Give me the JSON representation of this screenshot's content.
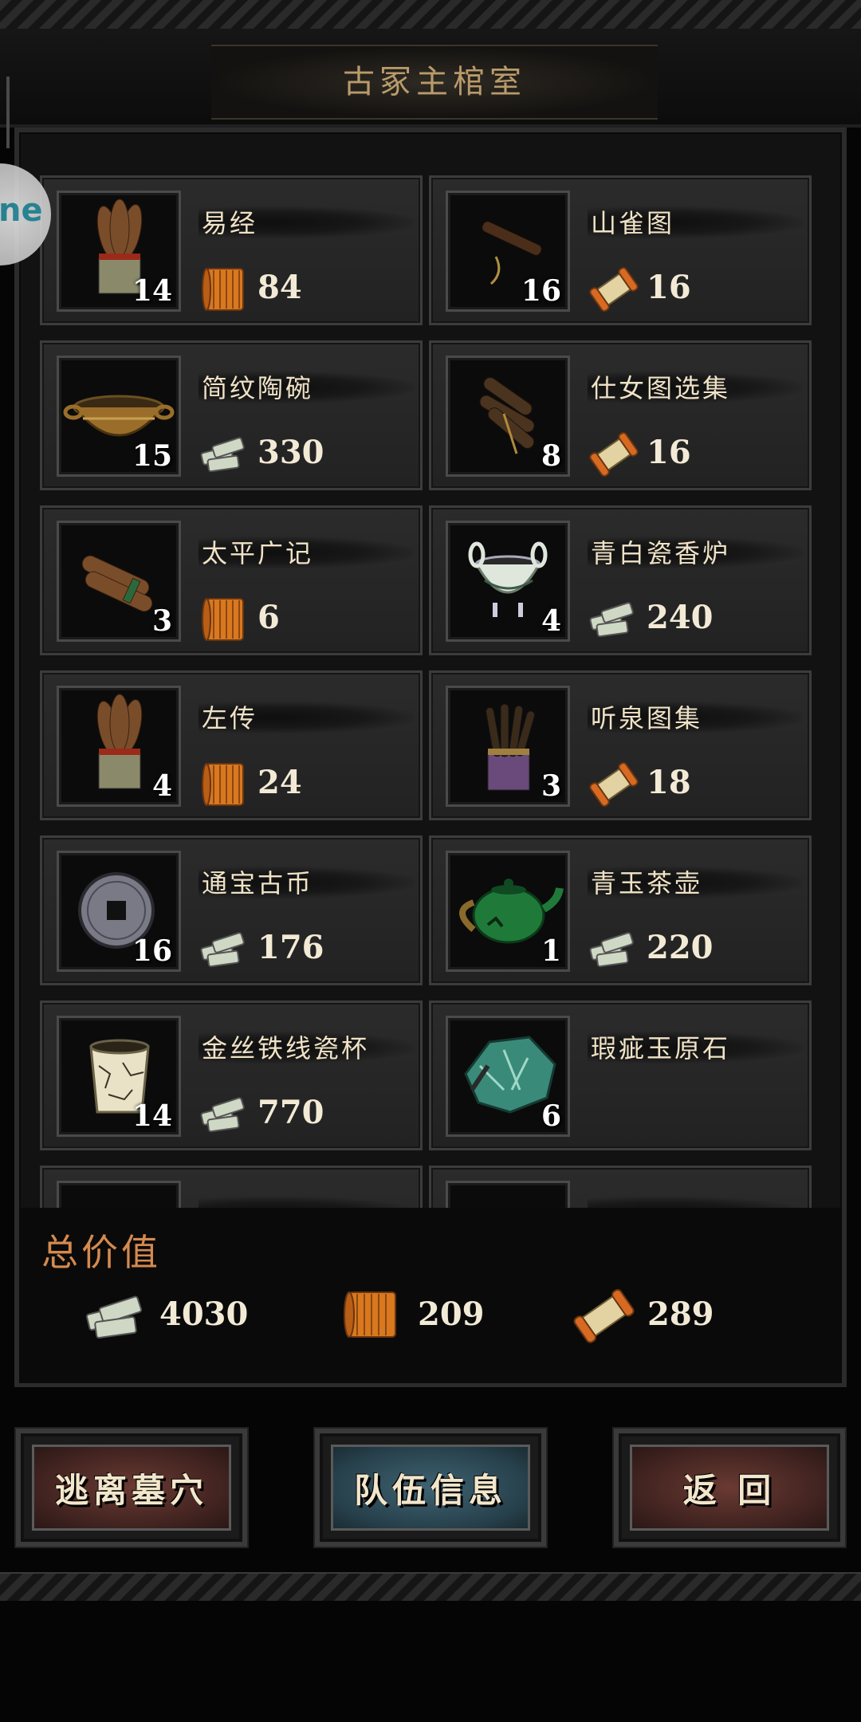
{
  "header": {
    "title": "古冢主棺室"
  },
  "floating_badge": {
    "text": "ne"
  },
  "items": [
    {
      "name": "易经",
      "count": "14",
      "value": "84",
      "currency": "bamboo-slip-icon",
      "art": "scroll-bundle"
    },
    {
      "name": "山雀图",
      "count": "16",
      "value": "16",
      "currency": "paper-scroll-icon",
      "art": "rolled-scroll"
    },
    {
      "name": "简纹陶碗",
      "count": "15",
      "value": "330",
      "currency": "silver-ingot-icon",
      "art": "bowl"
    },
    {
      "name": "仕女图选集",
      "count": "8",
      "value": "16",
      "currency": "paper-scroll-icon",
      "art": "scroll-bundle-dark"
    },
    {
      "name": "太平广记",
      "count": "3",
      "value": "6",
      "currency": "bamboo-slip-icon",
      "art": "rolled-bundle"
    },
    {
      "name": "青白瓷香炉",
      "count": "4",
      "value": "240",
      "currency": "silver-ingot-icon",
      "art": "censer"
    },
    {
      "name": "左传",
      "count": "4",
      "value": "24",
      "currency": "bamboo-slip-icon",
      "art": "scroll-bundle"
    },
    {
      "name": "听泉图集",
      "count": "3",
      "value": "18",
      "currency": "paper-scroll-icon",
      "art": "scroll-bundle-purple"
    },
    {
      "name": "通宝古币",
      "count": "16",
      "value": "176",
      "currency": "silver-ingot-icon",
      "art": "coin"
    },
    {
      "name": "青玉茶壶",
      "count": "1",
      "value": "220",
      "currency": "silver-ingot-icon",
      "art": "teapot"
    },
    {
      "name": "金丝铁线瓷杯",
      "count": "14",
      "value": "770",
      "currency": "silver-ingot-icon",
      "art": "cup"
    },
    {
      "name": "瑕疵玉原石",
      "count": "6",
      "value": "",
      "currency": "",
      "art": "jade-stone"
    },
    {
      "name": "",
      "count": "",
      "value": "",
      "currency": "",
      "art": ""
    },
    {
      "name": "",
      "count": "",
      "value": "",
      "currency": "",
      "art": ""
    }
  ],
  "totals": {
    "title": "总价值",
    "silver": "4030",
    "bamboo": "209",
    "paper": "289"
  },
  "buttons": {
    "escape": "逃离墓穴",
    "team": "队伍信息",
    "back": "返 回"
  }
}
